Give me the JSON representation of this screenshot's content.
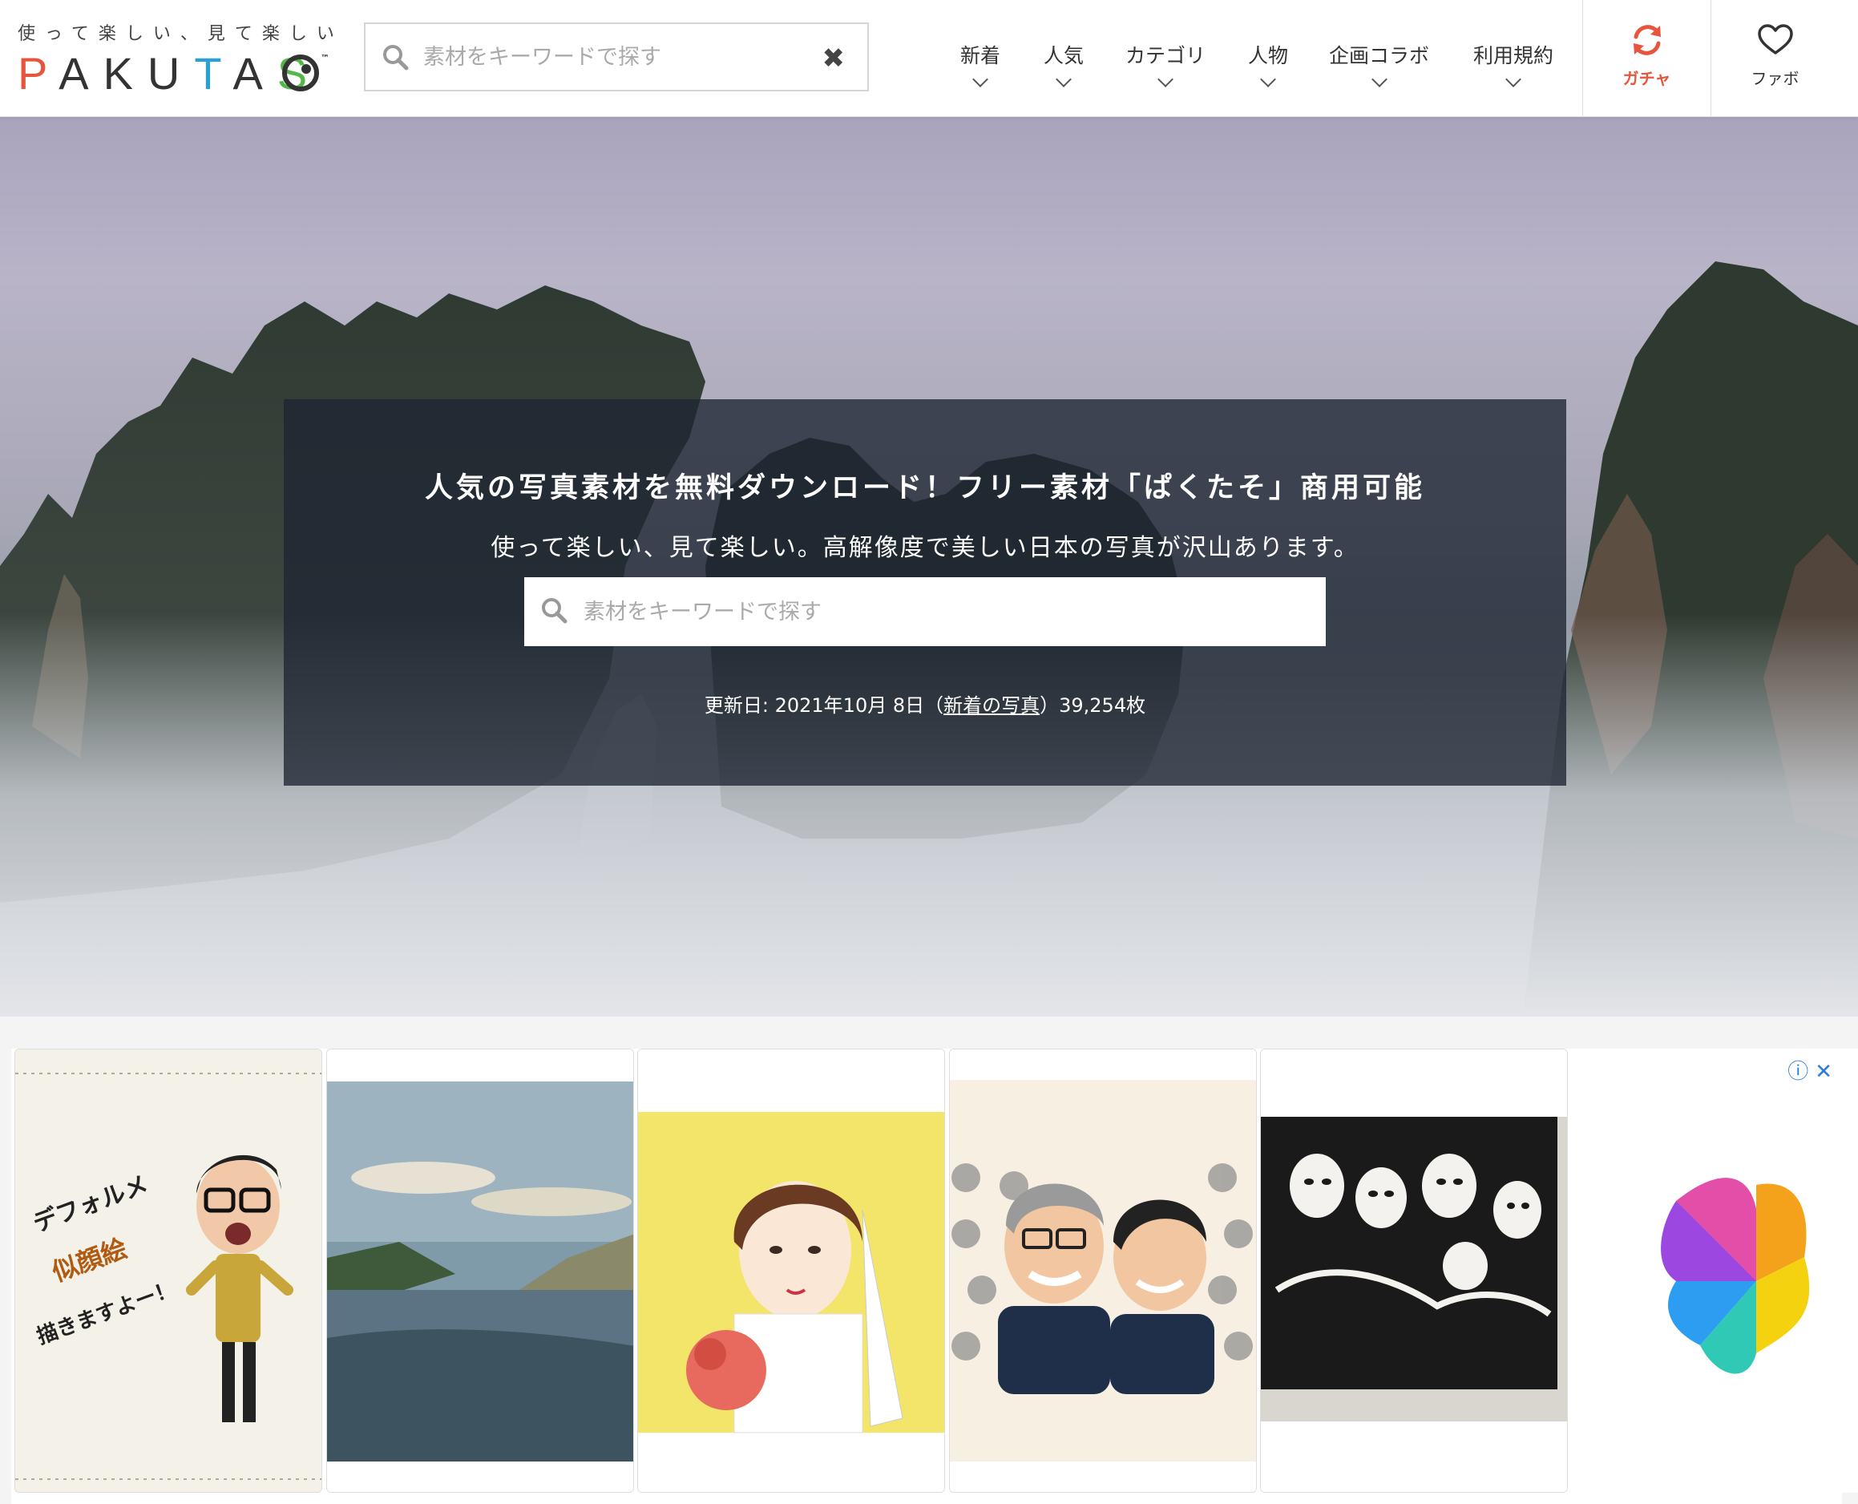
{
  "header": {
    "tagline": "使って楽しい、見て楽しい",
    "wordmark_letters": [
      "P",
      "A",
      "K",
      "U",
      "T",
      "A",
      "S"
    ],
    "trademark": "™",
    "search_placeholder": "素材をキーワードで探す",
    "nav": [
      {
        "label": "新着"
      },
      {
        "label": "人気"
      },
      {
        "label": "カテゴリ"
      },
      {
        "label": "人物"
      },
      {
        "label": "企画コラボ"
      },
      {
        "label": "利用規約"
      }
    ],
    "gacha_label": "ガチャ",
    "fav_label": "ファボ"
  },
  "hero": {
    "title": "人気の写真素材を無料ダウンロード！フリー素材「ぱくたそ」商用可能",
    "subtitle": "使って楽しい、見て楽しい。高解像度で美しい日本の写真が沢山あります。",
    "search_placeholder": "素材をキーワードで探す",
    "updated_prefix": "更新日: 2021年10月 8日（",
    "updated_link": "新着の写真",
    "updated_suffix": "）39,254枚"
  },
  "ads": {
    "info_icon": "ⓘ",
    "close_icon": "✕",
    "card1_lines": [
      "デフォルメ",
      "似顔絵",
      "描きますよー！"
    ]
  },
  "colors": {
    "accent": "#e8553d",
    "link_blue": "#2b7cd8",
    "hero_panel": "#1e2532"
  }
}
